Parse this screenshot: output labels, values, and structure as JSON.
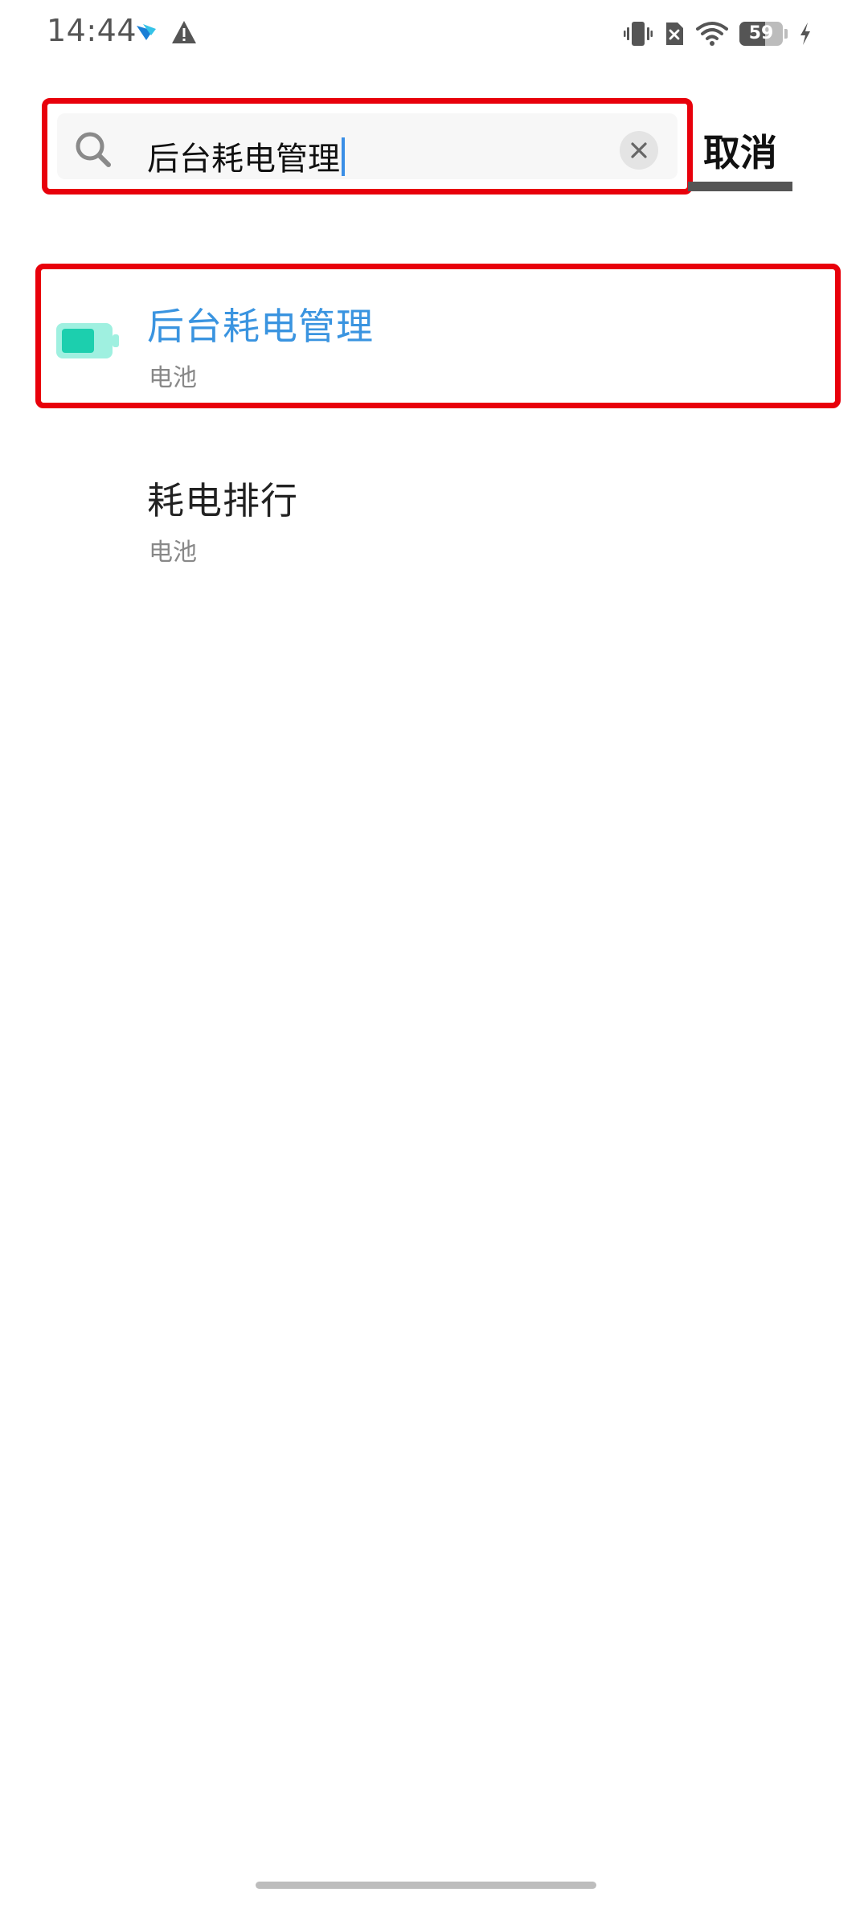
{
  "status_bar": {
    "time": "14:44",
    "battery_level": "59",
    "battery_fraction": 0.59,
    "icons": [
      "app-notification-icon",
      "warning-icon",
      "vibrate-icon",
      "no-sim-icon",
      "wifi-icon",
      "battery-icon",
      "charging-icon"
    ]
  },
  "search": {
    "value": "后台耗电管理",
    "placeholder": "",
    "clear_icon": "clear-icon",
    "search_icon": "search-icon"
  },
  "cancel": {
    "label": "取消"
  },
  "results": [
    {
      "title": "后台耗电管理",
      "subtitle": "电池",
      "icon": "battery-icon"
    },
    {
      "title": "耗电排行",
      "subtitle": "电池"
    }
  ],
  "colors": {
    "accent": "#3a94e0",
    "highlight_frame": "#e8000b",
    "battery_icon": "#1ccfae",
    "battery_icon_light": "#9ff0e0"
  }
}
